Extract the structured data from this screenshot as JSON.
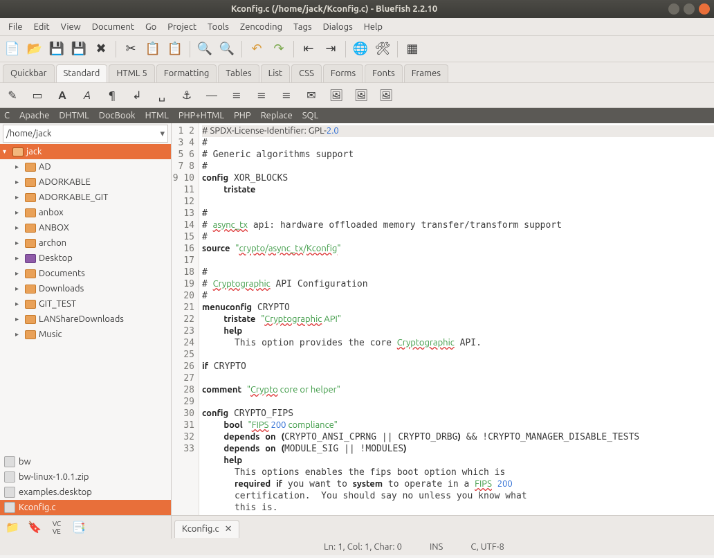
{
  "title": "Kconfig.c (/home/jack/Kconfig.c) - Bluefish 2.2.10",
  "menus": [
    "File",
    "Edit",
    "View",
    "Document",
    "Go",
    "Project",
    "Tools",
    "Zencoding",
    "Tags",
    "Dialogs",
    "Help"
  ],
  "tabs": [
    "Quickbar",
    "Standard",
    "HTML 5",
    "Formatting",
    "Tables",
    "List",
    "CSS",
    "Forms",
    "Fonts",
    "Frames"
  ],
  "active_tab": 1,
  "langs": [
    "C",
    "Apache",
    "DHTML",
    "DocBook",
    "HTML",
    "PHP+HTML",
    "PHP",
    "Replace",
    "SQL"
  ],
  "path": "/home/jack",
  "root_folder": "jack",
  "folders": [
    "AD",
    "ADORKABLE",
    "ADORKABLE_GIT",
    "anbox",
    "ANBOX",
    "archon",
    "Desktop",
    "Documents",
    "Downloads",
    "GIT_TEST",
    "LANShareDownloads",
    "Music"
  ],
  "purple_index": 6,
  "files": [
    {
      "name": "bw",
      "sel": false
    },
    {
      "name": "bw-linux-1.0.1.zip",
      "sel": false
    },
    {
      "name": "examples.desktop",
      "sel": false
    },
    {
      "name": "Kconfig.c",
      "sel": true
    }
  ],
  "doc_tab": "Kconfig.c",
  "status": {
    "pos": "Ln: 1, Col: 1, Char: 0",
    "ins": "INS",
    "enc": "C, UTF-8"
  },
  "code_lines": 33,
  "chart_data": {
    "type": "table",
    "title": "Kconfig.c source (lines 1–33)",
    "rows": [
      "# SPDX-License-Identifier: GPL-2.0",
      "#",
      "# Generic algorithms support",
      "#",
      "config XOR_BLOCKS",
      "    tristate",
      "",
      "#",
      "# async_tx api: hardware offloaded memory transfer/transform support",
      "#",
      "source \"crypto/async_tx/Kconfig\"",
      "",
      "#",
      "# Cryptographic API Configuration",
      "#",
      "menuconfig CRYPTO",
      "    tristate \"Cryptographic API\"",
      "    help",
      "      This option provides the core Cryptographic API.",
      "",
      "if CRYPTO",
      "",
      "comment \"Crypto core or helper\"",
      "",
      "config CRYPTO_FIPS",
      "    bool \"FIPS 200 compliance\"",
      "    depends on (CRYPTO_ANSI_CPRNG || CRYPTO_DRBG) && !CRYPTO_MANAGER_DISABLE_TESTS",
      "    depends on (MODULE_SIG || !MODULES)",
      "    help",
      "      This options enables the fips boot option which is",
      "      required if you want to system to operate in a FIPS 200",
      "      certification.  You should say no unless you know what",
      "      this is."
    ]
  }
}
